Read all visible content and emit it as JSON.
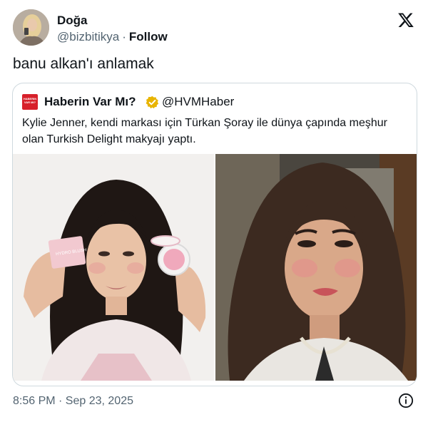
{
  "author": {
    "name": "Doğa",
    "handle": "@bizbitikya",
    "separator": "·",
    "follow_label": "Follow",
    "avatar_icon": "user-avatar-photo"
  },
  "tweet": {
    "text": "banu alkan'ı anlamak",
    "timestamp": "8:56 PM · Sep 23, 2025"
  },
  "quoted": {
    "name": "Haberin Var Mı?",
    "handle": "@HVMHaber",
    "logo_text": "HABERIN VAR MI?",
    "verified_badge_color": "#e8b400",
    "text": "Kylie Jenner, kendi markası için Türkan Şoray ile dünya çapında meşhur olan Turkish Delight makyajı yaptı.",
    "images": [
      {
        "alt": "photo-left",
        "packaging_text": "HYDRO BLUSH"
      },
      {
        "alt": "photo-right"
      }
    ]
  },
  "colors": {
    "text_primary": "#0f1419",
    "text_secondary": "#536471",
    "border": "#cfd9de",
    "logo_red": "#d7202a"
  },
  "icons": {
    "platform": "x-logo-icon",
    "info": "info-icon",
    "verified": "verified-badge-icon"
  }
}
